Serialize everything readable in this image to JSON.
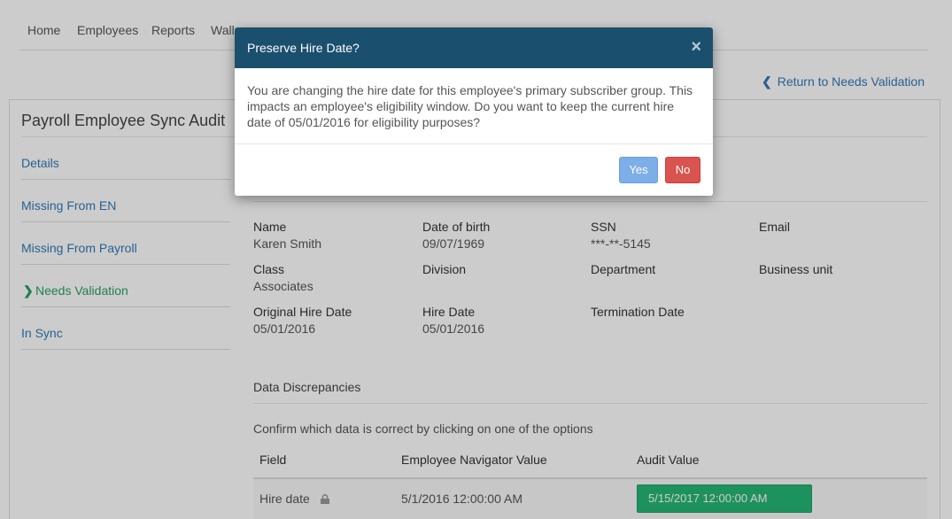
{
  "nav": {
    "items": [
      "Home",
      "Employees",
      "Reports",
      "Wall"
    ]
  },
  "return_link": "Return to Needs Validation",
  "panel": {
    "title": "Payroll Employee Sync Audit",
    "sidenav": [
      {
        "label": "Details",
        "active": false
      },
      {
        "label": "Missing From EN",
        "active": false
      },
      {
        "label": "Missing From Payroll",
        "active": false
      },
      {
        "label": "Needs Validation",
        "active": true
      },
      {
        "label": "In Sync",
        "active": false
      }
    ]
  },
  "employee": {
    "name_label": "Name",
    "name": "Karen Smith",
    "dob_label": "Date of birth",
    "dob": "09/07/1969",
    "ssn_label": "SSN",
    "ssn": "***-**-5145",
    "email_label": "Email",
    "email": "",
    "class_label": "Class",
    "class": "Associates",
    "division_label": "Division",
    "division": "",
    "department_label": "Department",
    "department": "",
    "business_unit_label": "Business unit",
    "business_unit": "",
    "orig_hire_label": "Original Hire Date",
    "orig_hire": "05/01/2016",
    "hire_label": "Hire Date",
    "hire": "05/01/2016",
    "termination_label": "Termination Date",
    "termination": ""
  },
  "discrepancies": {
    "title": "Data Discrepancies",
    "instructions": "Confirm which data is correct by clicking on one of the options",
    "columns": [
      "Field",
      "Employee Navigator Value",
      "Audit Value"
    ],
    "rows": [
      {
        "field": "Hire date",
        "locked": true,
        "en_value": "5/1/2016 12:00:00 AM",
        "audit_value": "5/15/2017 12:00:00 AM"
      }
    ]
  },
  "modal": {
    "title": "Preserve Hire Date?",
    "body": "You are changing the hire date for this employee's primary subscriber group. This impacts an employee's eligibility window. Do you want to keep the current hire date of 05/01/2016 for eligibility purposes?",
    "yes_label": "Yes",
    "no_label": "No",
    "close_glyph": "×"
  },
  "colors": {
    "modal_header": "#1b4f6e",
    "link": "#337ab7",
    "active_nav": "#2aa069",
    "audit_button": "#26b776",
    "yes_button": "#7eaee8",
    "no_button": "#d9534f"
  }
}
